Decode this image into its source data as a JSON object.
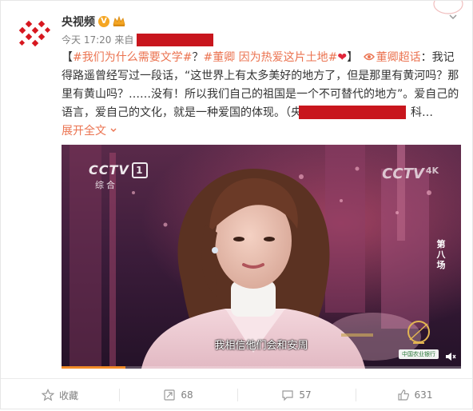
{
  "post": {
    "author": "央视频",
    "time": "今天 17:20",
    "source_prefix": "来自",
    "text": {
      "bracket_open": "【",
      "tag1": "#我们为什么需要文学#",
      "sep1": "？",
      "tag2": "#董卿 因为热爱这片土地#",
      "heart": "❤",
      "bracket_close": "】",
      "topic_link": "董卿超话",
      "body": "：我记得路遥曾经写过一段话，“这世界上有太多美好的地方了，但是那里有黄河吗？那里有黄山吗？……没有！所以我们自己的祖国是一个不可替代的地方”。爱自己的语言，爱自己的文化，就是一种爱国的体现。（",
      "body_tail": "央视频",
      "body_end": "科…",
      "expand": "展开全文",
      "expand_icon": "chevron-down-icon"
    }
  },
  "video": {
    "channel_logo": "CCTV",
    "channel_num": "1",
    "channel_sub": "综合",
    "right_logo": "CCTV",
    "right_logo_suffix": "4K",
    "episode": "第八场",
    "subtitle": "我相信他们会和安周",
    "sponsor": "中国农业银行",
    "progress": 0.16,
    "colors": {
      "progress": "#f28c28"
    }
  },
  "actions": [
    {
      "icon": "star-icon",
      "label": "收藏"
    },
    {
      "icon": "repost-icon",
      "label": "68"
    },
    {
      "icon": "comment-icon",
      "label": "57"
    },
    {
      "icon": "like-icon",
      "label": "631"
    }
  ],
  "colors": {
    "accent": "#eb7350",
    "redaction": "#c8161d",
    "verified": "#f5a623"
  }
}
